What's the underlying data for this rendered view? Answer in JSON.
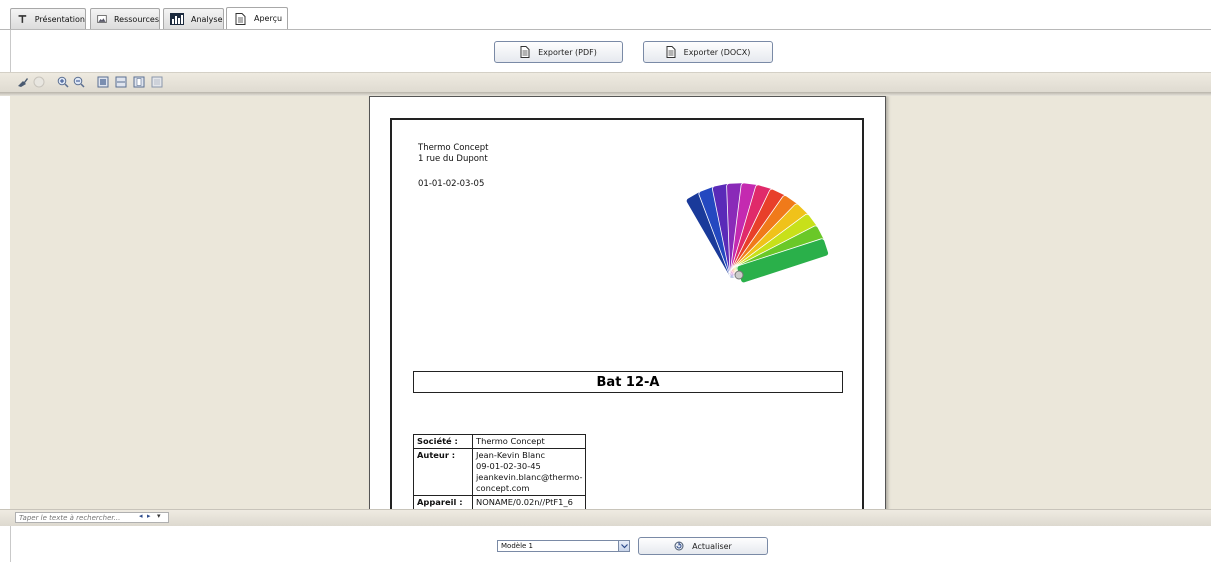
{
  "tabs": [
    {
      "label": "Présentation",
      "icon": "text-icon"
    },
    {
      "label": "Ressources",
      "icon": "image-icon"
    },
    {
      "label": "Analyse",
      "icon": "chart-icon"
    },
    {
      "label": "Aperçu",
      "icon": "document-icon"
    }
  ],
  "active_tab": "Aperçu",
  "export": {
    "pdf_label": "Exporter (PDF)",
    "docx_label": "Exporter (DOCX)"
  },
  "toolbar": {
    "tools": [
      "export-icon",
      "print-icon",
      "zoom-in-icon",
      "zoom-out-icon",
      "fit-page-icon",
      "fit-width-icon",
      "single-page-icon",
      "multi-page-icon"
    ]
  },
  "document": {
    "company": "Thermo Concept",
    "address": "1 rue du Dupont",
    "phone": "01-01-02-03-05",
    "title": "Bat 12-A",
    "rows": [
      {
        "key": "Société :",
        "value": "Thermo Concept"
      },
      {
        "key": "Auteur :",
        "value": "Jean-Kevin Blanc\n09-01-02-30-45\njeankevin.blanc@thermo-concept.com"
      },
      {
        "key": "Appareil :",
        "value": "NONAME/0.02n//PtF1_6"
      }
    ]
  },
  "search": {
    "placeholder": "Taper le texte à rechercher..."
  },
  "bottom": {
    "model_value": "Modèle 1",
    "refresh_label": "Actualiser"
  }
}
